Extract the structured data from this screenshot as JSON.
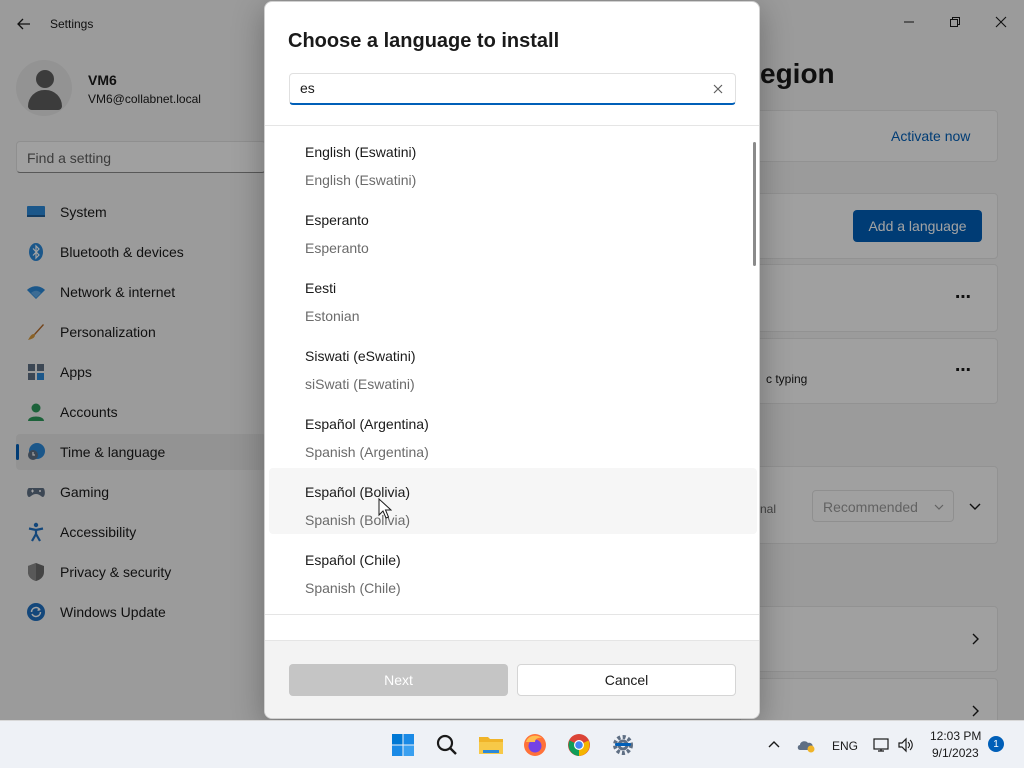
{
  "window": {
    "app_title": "Settings"
  },
  "profile": {
    "name": "VM6",
    "email": "VM6@collabnet.local"
  },
  "search": {
    "placeholder": "Find a setting"
  },
  "sidebar": {
    "items": [
      {
        "label": "System",
        "icon": "system-icon"
      },
      {
        "label": "Bluetooth & devices",
        "icon": "bluetooth-icon"
      },
      {
        "label": "Network & internet",
        "icon": "wifi-icon"
      },
      {
        "label": "Personalization",
        "icon": "brush-icon"
      },
      {
        "label": "Apps",
        "icon": "apps-icon"
      },
      {
        "label": "Accounts",
        "icon": "accounts-icon"
      },
      {
        "label": "Time & language",
        "icon": "time-language-icon",
        "active": true
      },
      {
        "label": "Gaming",
        "icon": "gamepad-icon"
      },
      {
        "label": "Accessibility",
        "icon": "accessibility-icon"
      },
      {
        "label": "Privacy & security",
        "icon": "shield-icon"
      },
      {
        "label": "Windows Update",
        "icon": "update-icon"
      }
    ]
  },
  "background_page": {
    "heading_fragment": "egion",
    "activate_label": "Activate now",
    "add_language_label": "Add a language",
    "typing_fragment": "c typing",
    "regional_fragment": "nal",
    "recommended_value": "Recommended"
  },
  "dialog": {
    "title": "Choose a language to install",
    "search_value": "es",
    "languages": [
      {
        "native": "English (Eswatini)",
        "english": "English (Eswatini)"
      },
      {
        "native": "Esperanto",
        "english": "Esperanto"
      },
      {
        "native": "Eesti",
        "english": "Estonian"
      },
      {
        "native": "Siswati (eSwatini)",
        "english": "siSwati (Eswatini)"
      },
      {
        "native": "Español (Argentina)",
        "english": "Spanish (Argentina)"
      },
      {
        "native": "Español (Bolivia)",
        "english": "Spanish (Bolivia)",
        "hovered": true
      },
      {
        "native": "Español (Chile)",
        "english": "Spanish (Chile)"
      }
    ],
    "next_label": "Next",
    "cancel_label": "Cancel"
  },
  "taskbar": {
    "apps": [
      "start-icon",
      "search-icon",
      "file-explorer-icon",
      "firefox-icon",
      "chrome-icon",
      "settings-icon"
    ],
    "language": "ENG",
    "time": "12:03 PM",
    "date": "9/1/2023",
    "notification_count": "1"
  },
  "colors": {
    "accent": "#005fb8",
    "dialog_bg": "#ffffff",
    "settings_bg": "#f3f3f3",
    "taskbar_bg": "#eef1f6"
  }
}
